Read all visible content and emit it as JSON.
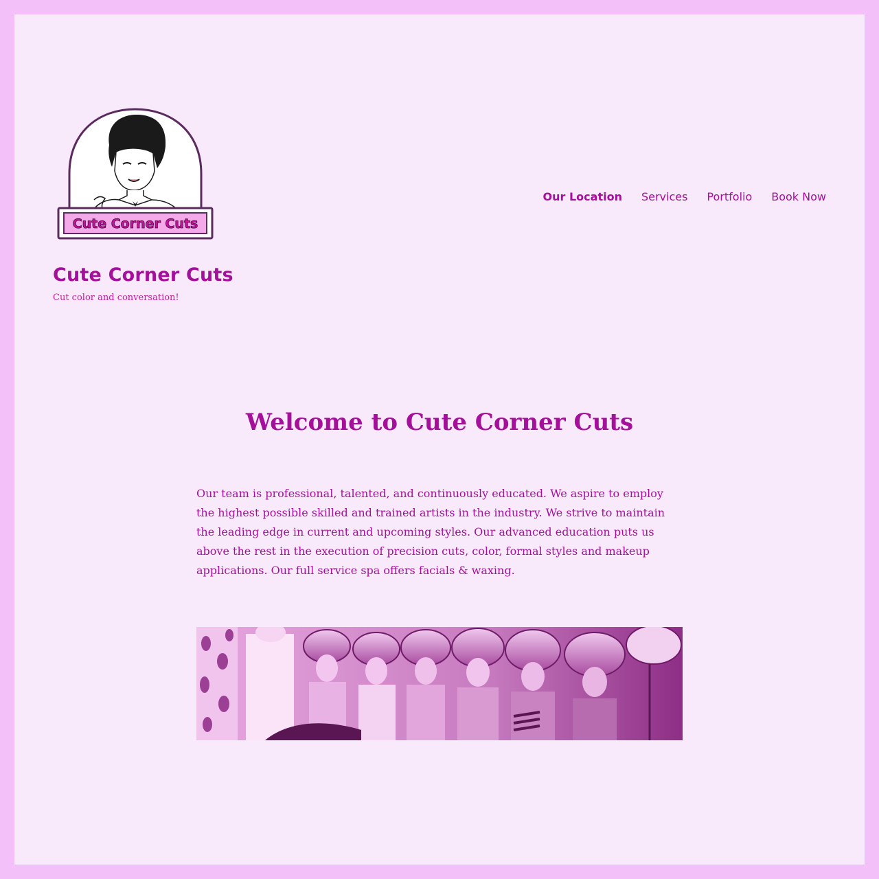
{
  "site": {
    "title": "Cute Corner Cuts",
    "tagline": "Cut color and conversation!",
    "logo_text": "Cute Corner Cuts"
  },
  "nav": {
    "items": [
      {
        "label": "Our Location",
        "active": true
      },
      {
        "label": "Services"
      },
      {
        "label": "Portfolio"
      },
      {
        "label": "Book Now"
      }
    ]
  },
  "main": {
    "headline": "Welcome to Cute Corner Cuts",
    "intro": "Our team is professional, talented, and continuously educated. We aspire to employ the highest possible skilled and trained artists in the industry. We strive to maintain the leading edge in current and upcoming styles. Our advanced education puts us above the rest in the execution of precision cuts, color, formal styles and makeup applications. Our full service spa offers facials & waxing."
  },
  "colors": {
    "outer_bg": "#f4c0fa",
    "page_bg": "#f8eafb",
    "accent": "#a4109a",
    "tagline": "#c41a9e"
  }
}
